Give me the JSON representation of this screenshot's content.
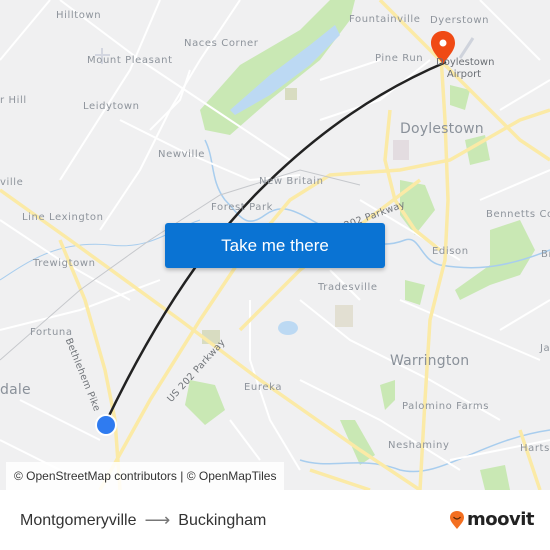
{
  "map": {
    "labels": {
      "hilltown": "Hilltown",
      "mount_pleasant": "Mount Pleasant",
      "naces_corner": "Naces Corner",
      "leidytown": "Leidytown",
      "hill": "r Hill",
      "newville": "Newville",
      "ville": "ville",
      "new_britain": "New Britain",
      "forest_park": "Forest Park",
      "line_lexington": "Line Lexington",
      "trewigtown": "Trewigtown",
      "fortuna": "Fortuna",
      "dale": "dale",
      "bethlehem_pike": "Bethlehem Pike",
      "us202_parkway": "US 202 Parkway",
      "parkway_202": "202 Parkway",
      "eureka": "Eureka",
      "tradesville": "Tradesville",
      "fountainville": "Fountainville",
      "dyerstown": "Dyerstown",
      "pine_run": "Pine Run",
      "doylestown_airport": "Doylestown Airport",
      "doylestown": "Doylestown",
      "bennetts_corner": "Bennetts Co",
      "br": "Br",
      "edison": "Edison",
      "warrington": "Warrington",
      "palomino_farms": "Palomino Farms",
      "neshaminy": "Neshaminy",
      "hartsville": "Hartsv",
      "ja": "Ja"
    },
    "route": {
      "origin_marker": "origin-dot",
      "destination_marker": "destination-pin",
      "origin_color": "#2f7bf0",
      "destination_color": "#f04a14",
      "line_color": "#222222"
    },
    "cta_button": "Take me there",
    "attribution": "© OpenStreetMap contributors | © OpenMapTiles"
  },
  "footer": {
    "from": "Montgomeryville",
    "arrow": "⟶",
    "to": "Buckingham",
    "brand": "moovit",
    "brand_color": "#f36f21"
  }
}
